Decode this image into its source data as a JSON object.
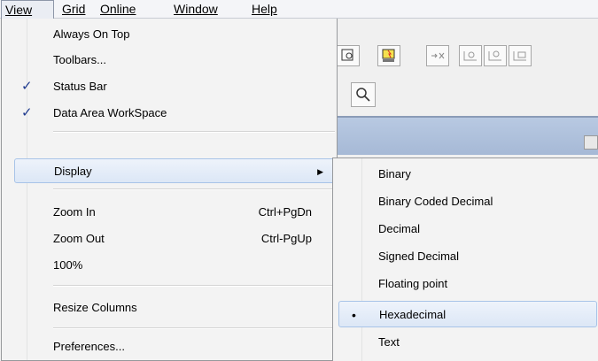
{
  "menubar": {
    "items": [
      {
        "label": "View"
      },
      {
        "label": "Grid"
      },
      {
        "label": "Online"
      },
      {
        "label": "Window"
      },
      {
        "label": "Help"
      }
    ]
  },
  "view_menu": {
    "always_on_top": "Always On Top",
    "toolbars": "Toolbars...",
    "status_bar": "Status Bar",
    "status_bar_checked": true,
    "data_area": "Data Area WorkSpace",
    "data_area_checked": true,
    "display": "Display",
    "zoom_in": "Zoom In",
    "zoom_in_shortcut": "Ctrl+PgDn",
    "zoom_out": "Zoom Out",
    "zoom_out_shortcut": "Ctrl-PgUp",
    "zoom_100": "100%",
    "resize_columns": "Resize Columns",
    "preferences": "Preferences...",
    "check_glyph": "✓",
    "arrow_glyph": "▶"
  },
  "display_submenu": {
    "items": [
      {
        "label": "Binary"
      },
      {
        "label": "Binary Coded Decimal"
      },
      {
        "label": "Decimal"
      },
      {
        "label": "Signed Decimal"
      },
      {
        "label": "Floating point"
      },
      {
        "label": "Hexadecimal"
      },
      {
        "label": "Text"
      }
    ],
    "selected": "Hexadecimal",
    "bullet_glyph": "•"
  },
  "colors": {
    "highlight_border": "#a8c4e8",
    "band": "#a6b9d6"
  }
}
